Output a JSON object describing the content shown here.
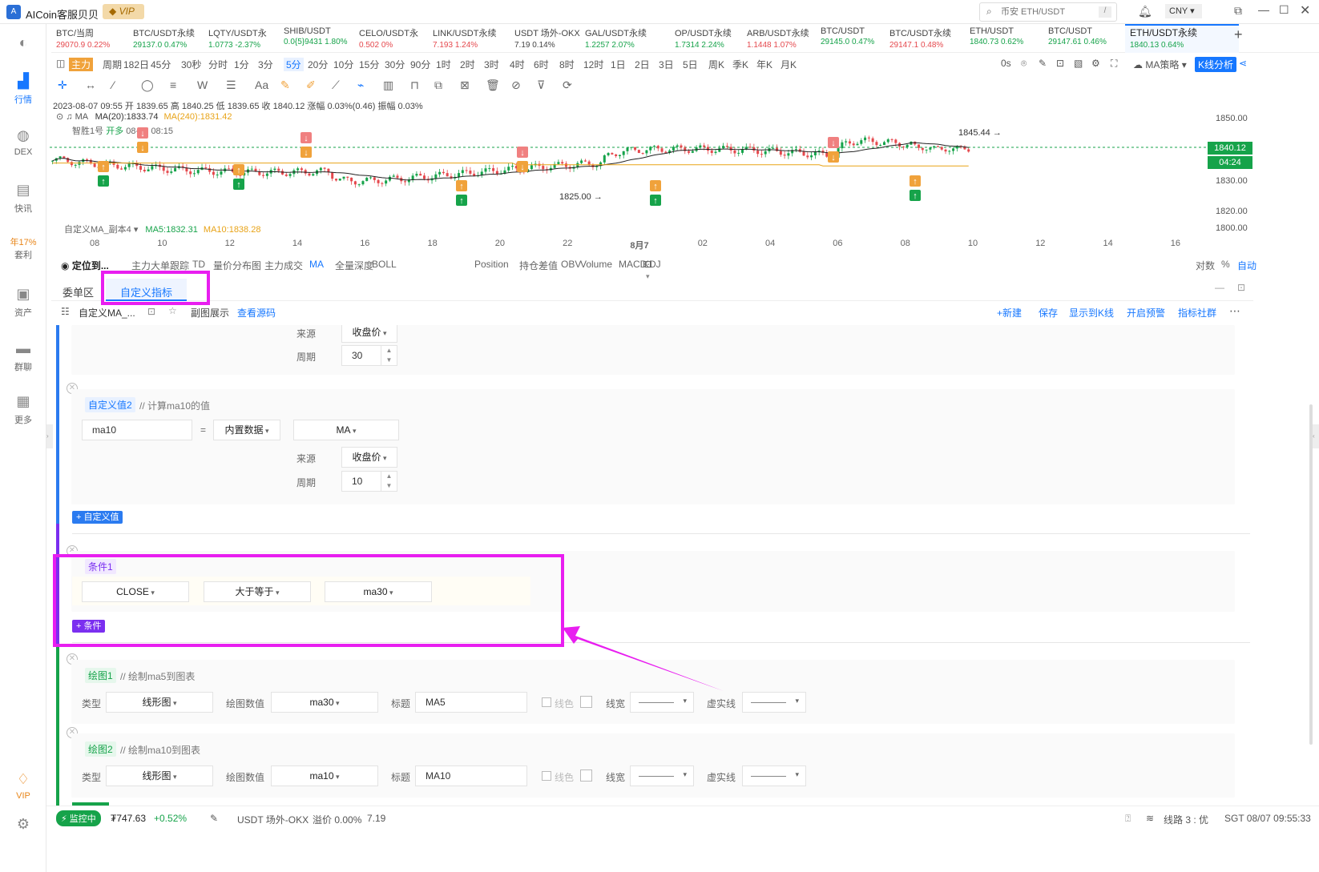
{
  "app": {
    "title": "AICoin客服贝贝",
    "vip": "VIP"
  },
  "titlebar": {
    "search_placeholder": "币安 ETH/USDT",
    "search_shortcut": "/",
    "currency": "CNY"
  },
  "sidebar": {
    "items": [
      {
        "label": "",
        "icon": "globe-icon"
      },
      {
        "label": "行情",
        "icon": "bar-chart-icon",
        "active": true
      },
      {
        "label": "DEX",
        "icon": "dex-icon"
      },
      {
        "label": "快讯",
        "icon": "news-icon"
      },
      {
        "label": "年17%",
        "sub": "套利",
        "icon": "arbitrage-icon"
      },
      {
        "label": "资产",
        "icon": "wallet-icon"
      },
      {
        "label": "群聊",
        "icon": "chat-icon"
      },
      {
        "label": "更多",
        "icon": "more-icon"
      },
      {
        "label": "VIP",
        "icon": "vip-icon"
      },
      {
        "label": "",
        "icon": "settings-icon"
      }
    ]
  },
  "tickers": [
    {
      "name": "BTC/当周",
      "price": "29070.9",
      "change": "0.22%",
      "dir": "dn"
    },
    {
      "name": "BTC/USDT永续",
      "price": "29137.0",
      "change": "0.47%",
      "dir": "up"
    },
    {
      "name": "LQTY/USDT永",
      "price": "1.0773",
      "change": "-2.37%",
      "dir": "up"
    },
    {
      "name": "SHIB/USDT",
      "price": "0.0{5}9431",
      "change": "1.80%",
      "dir": "up"
    },
    {
      "name": "CELO/USDT永",
      "price": "0.502",
      "change": "0%",
      "dir": "dn"
    },
    {
      "name": "LINK/USDT永续",
      "price": "7.193",
      "change": "1.24%",
      "dir": "dn"
    },
    {
      "name": "USDT 场外-OKX",
      "price": "7.19",
      "change": "0.14%",
      "dir": "none"
    },
    {
      "name": "GAL/USDT永续",
      "price": "1.2257",
      "change": "2.07%",
      "dir": "up"
    },
    {
      "name": "OP/USDT永续",
      "price": "1.7314",
      "change": "2.24%",
      "dir": "up"
    },
    {
      "name": "ARB/USDT永续",
      "price": "1.1448",
      "change": "1.07%",
      "dir": "dn"
    },
    {
      "name": "BTC/USDT",
      "price": "29145.0",
      "change": "0.47%",
      "dir": "up"
    },
    {
      "name": "BTC/USDT永续",
      "price": "29147.1",
      "change": "0.48%",
      "dir": "dn"
    },
    {
      "name": "ETH/USDT",
      "price": "1840.73",
      "change": "0.62%",
      "dir": "up"
    },
    {
      "name": "BTC/USDT",
      "price": "29147.61",
      "change": "0.46%",
      "dir": "up"
    },
    {
      "name": "ETH/USDT永续",
      "price": "1840.13",
      "change": "0.64%",
      "dir": "up",
      "active": true
    }
  ],
  "periods": [
    "主力",
    "周期",
    "182日",
    "45分",
    "30秒",
    "分时",
    "1分",
    "3分",
    "5分",
    "20分",
    "10分",
    "15分",
    "30分",
    "90分",
    "1时",
    "2时",
    "3时",
    "4时",
    "6时",
    "8时",
    "12时",
    "1日",
    "2日",
    "3日",
    "5日",
    "周K",
    "季K",
    "年K",
    "月K"
  ],
  "tabbar_right": {
    "countdown": "0s",
    "strategy": "MA策略",
    "analysis": "K线分析"
  },
  "chart_info": {
    "ohlc": "2023-08-07 09:55 开 1839.65 高 1840.25 低 1839.65 收 1840.12 涨幅 0.03%(0.46) 振幅 0.03%",
    "ma_label": "MA",
    "ma20": "MA(20):1833.74",
    "ma240": "MA(240):1831.42",
    "signal_name": "智胜1号",
    "signal_action": "开多",
    "signal_time": "08-07 08:15",
    "custom_ma": "自定义MA_副本4",
    "ma5": "MA5:1832.31",
    "ma10": "MA10:1838.28",
    "high_note": "1845.44 →",
    "low_note": "1825.00 →"
  },
  "price_axis": {
    "ticks": [
      "1850.00",
      "1840.00",
      "1830.00",
      "1820.00",
      "1800.00"
    ],
    "last": "1840.12",
    "countdown": "04:24"
  },
  "time_axis": [
    "08",
    "10",
    "12",
    "14",
    "16",
    "18",
    "20",
    "22",
    "8月7",
    "02",
    "04",
    "06",
    "08",
    "10",
    "12",
    "14",
    "16"
  ],
  "indicator_bar": {
    "locate": "定位到...",
    "items": [
      "主力大单跟踪",
      "TD",
      "量价分布图",
      "主力成交",
      "MA",
      "全量深度",
      "BOLL",
      "Position",
      "持仓差值",
      "OBV",
      "Volume",
      "MACD",
      "KDJ"
    ],
    "right": [
      "对数",
      "%",
      "自动"
    ]
  },
  "panel_tabs": [
    "委单区",
    "自定义指标"
  ],
  "panel_toolbar": {
    "name": "自定义MA_...",
    "sub_display": "副图展示",
    "view_source": "查看源码",
    "actions": [
      "+新建",
      "保存",
      "显示到K线",
      "开启预警",
      "指标社群"
    ]
  },
  "editor": {
    "source_label": "来源",
    "period_label": "周期",
    "close_price": "收盘价",
    "period1": "30",
    "custom2": {
      "tag": "自定义值2",
      "comment": "// 计算ma10的值",
      "var": "ma10",
      "eq": "=",
      "type": "内置数据",
      "func": "MA",
      "period": "10"
    },
    "add_custom": "+ 自定义值",
    "cond1": {
      "tag": "条件1",
      "left": "CLOSE",
      "op": "大于等于",
      "right": "ma30"
    },
    "add_cond": "+ 条件",
    "plot1": {
      "tag": "绘图1",
      "comment": "// 绘制ma5到图表",
      "type": "线形图",
      "value": "ma30",
      "title": "MA5"
    },
    "plot2": {
      "tag": "绘图2",
      "comment": "// 绘制ma10到图表",
      "type": "线形图",
      "value": "ma10",
      "title": "MA10"
    },
    "type_label": "类型",
    "value_label": "绘图数值",
    "title_label": "标题",
    "color_label": "线色",
    "width_label": "线宽",
    "dash_label": "虚实线"
  },
  "status": {
    "monitor": "监控中",
    "value": "₮747.63",
    "change": "+0.52%",
    "market": "USDT 场外-OKX",
    "premium": "溢价 0.00%",
    "price": "7.19",
    "line": "线路 3 : 优",
    "time": "SGT 08/07 09:55:33"
  },
  "colors": {
    "accent": "#1677ff",
    "up": "#16a34a",
    "down": "#e5484d",
    "highlight": "#e81ef0"
  }
}
